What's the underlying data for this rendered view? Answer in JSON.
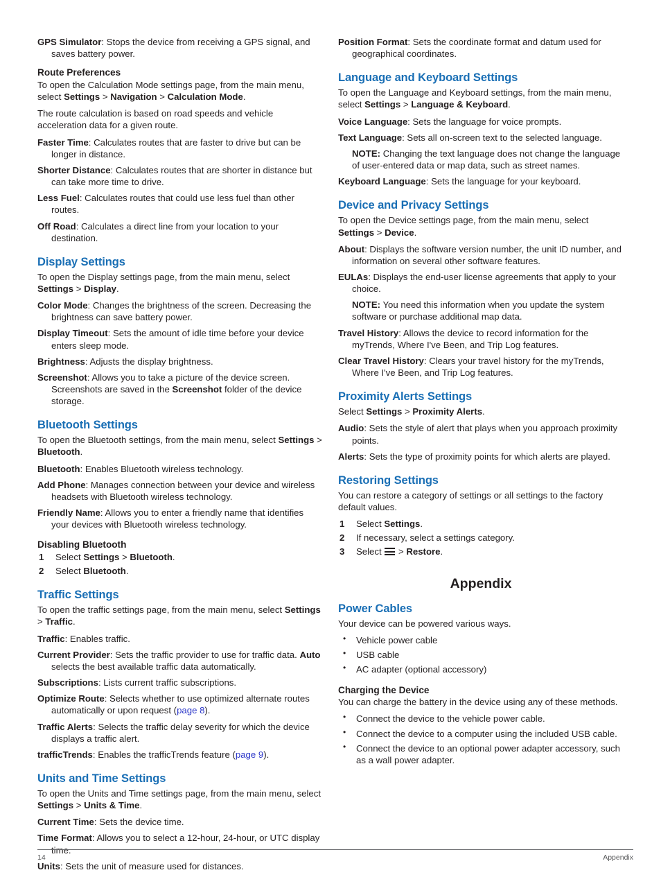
{
  "document": {
    "page_number": "14",
    "footer_section": "Appendix",
    "heading_color": "#1a6fb5",
    "link_color": "#2c37c9",
    "text_color": "#231f20"
  },
  "left_column": {
    "gps_sim": {
      "term": "GPS Simulator",
      "rest": ": Stops the device from receiving a GPS signal, and saves battery power."
    },
    "route_preferences": {
      "heading": "Route Preferences",
      "intro_a": "To open the Calculation Mode settings page, from the main menu, select ",
      "intro_b": "Settings",
      "intro_c": " > ",
      "intro_d": "Navigation",
      "intro_e": " > ",
      "intro_f": "Calculation Mode",
      "intro_g": ".",
      "intro2": "The route calculation is based on road speeds and vehicle acceleration data for a given route.",
      "defs": [
        {
          "term": "Faster Time",
          "rest": ": Calculates routes that are faster to drive but can be longer in distance."
        },
        {
          "term": "Shorter Distance",
          "rest": ": Calculates routes that are shorter in distance but can take more time to drive."
        },
        {
          "term": "Less Fuel",
          "rest": ": Calculates routes that could use less fuel than other routes."
        },
        {
          "term": "Off Road",
          "rest": ": Calculates a direct line from your location to your destination."
        }
      ]
    },
    "display_settings": {
      "heading": "Display Settings",
      "intro_a": "To open the Display settings page, from the main menu, select ",
      "intro_b": "Settings",
      "intro_c": " > ",
      "intro_d": "Display",
      "intro_e": ".",
      "color_mode": {
        "term": "Color Mode",
        "rest": ": Changes the brightness of the screen. Decreasing the brightness can save battery power."
      },
      "display_timeout": {
        "term": "Display Timeout",
        "rest": ": Sets the amount of idle time before your device enters sleep mode."
      },
      "brightness": {
        "term": "Brightness",
        "rest": ": Adjusts the display brightness."
      },
      "screenshot": {
        "term": "Screenshot",
        "part1": ": Allows you to take a picture of the device screen. Screenshots are saved in the ",
        "emphasis": "Screenshot",
        "part2": " folder of the device storage."
      }
    },
    "bluetooth_settings": {
      "heading": "Bluetooth Settings",
      "intro_a": "To open the Bluetooth settings, from the main menu, select ",
      "intro_b": "Settings",
      "intro_c": " > ",
      "intro_d": "Bluetooth",
      "intro_e": ".",
      "defs": [
        {
          "term": "Bluetooth",
          "rest": ": Enables Bluetooth wireless technology."
        },
        {
          "term": "Add Phone",
          "rest": ": Manages connection between your device and wireless headsets with Bluetooth wireless technology."
        },
        {
          "term": "Friendly Name",
          "rest": ": Allows you to enter a friendly name that identifies your devices with Bluetooth wireless technology."
        }
      ],
      "disabling": {
        "heading": "Disabling Bluetooth",
        "step1_a": "Select ",
        "step1_b": "Settings",
        "step1_c": " > ",
        "step1_d": "Bluetooth",
        "step1_e": ".",
        "step2_a": "Select ",
        "step2_b": "Bluetooth",
        "step2_c": "."
      }
    },
    "traffic_settings": {
      "heading": "Traffic Settings",
      "intro_a": "To open the traffic settings page, from the main menu, select ",
      "intro_b": "Settings",
      "intro_c": " > ",
      "intro_d": "Traffic",
      "intro_e": ".",
      "traffic": {
        "term": "Traffic",
        "rest": ": Enables traffic."
      },
      "current_provider": {
        "term": "Current Provider",
        "part1": ": Sets the traffic provider to use for traffic data. ",
        "emphasis": "Auto",
        "part2": " selects the best available traffic data automatically."
      },
      "subscriptions": {
        "term": "Subscriptions",
        "rest": ": Lists current traffic subscriptions."
      },
      "optimize_route": {
        "term": "Optimize Route",
        "part1": ": Selects whether to use optimized alternate routes automatically or upon request (",
        "link": "page 8",
        "part2": ")."
      },
      "traffic_alerts": {
        "term": "Traffic Alerts",
        "rest": ": Selects the traffic delay severity for which the device displays a traffic alert."
      },
      "traffic_trends": {
        "term": "trafficTrends",
        "part1": ": Enables the trafficTrends feature (",
        "link": "page 9",
        "part2": ")."
      }
    },
    "units_time_settings": {
      "heading": "Units and Time Settings",
      "intro_a": "To open the Units and Time settings page, from the main menu, select ",
      "intro_b": "Settings",
      "intro_c": " > ",
      "intro_d": "Units & Time",
      "intro_e": ".",
      "defs": [
        {
          "term": "Current Time",
          "rest": ": Sets the device time."
        },
        {
          "term": "Time Format",
          "rest": ": Allows you to select a 12-hour, 24-hour, or UTC display time."
        },
        {
          "term": "Units",
          "rest": ": Sets the unit of measure used for distances."
        }
      ]
    }
  },
  "right_column": {
    "position_format": {
      "term": "Position Format",
      "rest": ": Sets the coordinate format and datum used for geographical coordinates."
    },
    "language_keyboard": {
      "heading": "Language and Keyboard Settings",
      "intro_a": "To open the Language and Keyboard settings, from the main menu, select ",
      "intro_b": "Settings",
      "intro_c": " > ",
      "intro_d": "Language & Keyboard",
      "intro_e": ".",
      "voice_language": {
        "term": "Voice Language",
        "rest": ": Sets the language for voice prompts."
      },
      "text_language": {
        "term": "Text Language",
        "rest": ": Sets all on-screen text to the selected language."
      },
      "note_label": "NOTE:",
      "note_text": " Changing the text language does not change the language of user-entered data or map data, such as street names.",
      "keyboard_language": {
        "term": "Keyboard Language",
        "rest": ": Sets the language for your keyboard."
      }
    },
    "device_privacy": {
      "heading": "Device and Privacy Settings",
      "intro_a": "To open the Device settings page, from the main menu, select ",
      "intro_b": "Settings",
      "intro_c": " > ",
      "intro_d": "Device",
      "intro_e": ".",
      "about": {
        "term": "About",
        "rest": ": Displays the software version number, the unit ID number, and information on several other software features."
      },
      "eulas": {
        "term": "EULAs",
        "rest": ": Displays the end-user license agreements that apply to your choice."
      },
      "note_label": "NOTE:",
      "note_text": " You need this information when you update the system software or purchase additional map data.",
      "travel_history": {
        "term": "Travel History",
        "rest": ": Allows the device to record information for the myTrends, Where I've Been, and Trip Log features."
      },
      "clear_travel_history": {
        "term": "Clear Travel History",
        "rest": ": Clears your travel history for the myTrends, Where I've Been, and Trip Log features."
      }
    },
    "proximity_alerts": {
      "heading": "Proximity Alerts Settings",
      "intro_a": "Select ",
      "intro_b": "Settings",
      "intro_c": " > ",
      "intro_d": "Proximity Alerts",
      "intro_e": ".",
      "audio": {
        "term": "Audio",
        "rest": ": Sets the style of alert that plays when you approach proximity points."
      },
      "alerts": {
        "term": "Alerts",
        "rest": ": Sets the type of proximity points for which alerts are played."
      }
    },
    "restoring_settings": {
      "heading": "Restoring Settings",
      "intro": "You can restore a category of settings or all settings to the factory default values.",
      "step1_a": "Select ",
      "step1_b": "Settings",
      "step1_c": ".",
      "step2": "If necessary, select a settings category.",
      "step3_a": "Select ",
      "step3_icon": "menu-icon",
      "step3_b": " > ",
      "step3_c": "Restore",
      "step3_d": "."
    },
    "appendix": {
      "title": "Appendix",
      "power_cables": {
        "heading": "Power Cables",
        "intro": "Your device can be powered various ways.",
        "items": [
          "Vehicle power cable",
          "USB cable",
          "AC adapter (optional accessory)"
        ]
      },
      "charging": {
        "heading": "Charging the Device",
        "intro": "You can charge the battery in the device using any of these methods.",
        "items": [
          "Connect the device to the vehicle power cable.",
          "Connect the device to a computer using the included USB cable.",
          "Connect the device to an optional power adapter accessory, such as a wall power adapter."
        ]
      }
    }
  }
}
